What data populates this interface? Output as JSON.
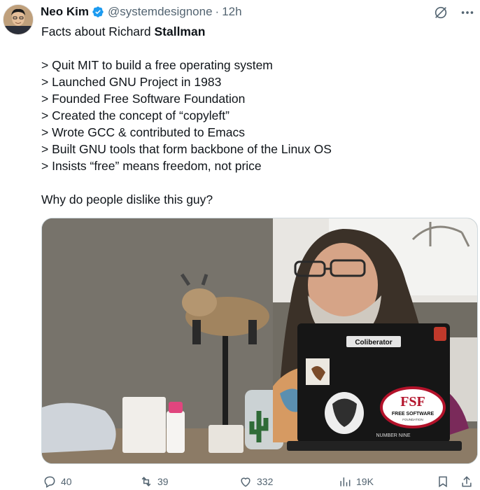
{
  "author": {
    "name": "Neo Kim",
    "handle": "@systemdesignone",
    "separator": "·",
    "time": "12h"
  },
  "tweet": {
    "title_prefix": "Facts about Richard ",
    "title_bold": "Stallman",
    "facts": [
      "> Quit MIT to build a free operating system",
      "> Launched GNU Project in 1983",
      "> Founded Free Software Foundation",
      "> Created the concept of “copyleft”",
      "> Wrote GCC & contributed to Emacs",
      "> Built GNU tools that form backbone of the Linux OS",
      "> Insists “free” means freedom, not price"
    ],
    "question": "Why do people dislike this guy?"
  },
  "media": {
    "laptop_sticker_brand": "Coliberator",
    "laptop_sticker_fsf": "FREE SOFTWARE",
    "laptop_sticker_fsf_sub": "FOUNDATION",
    "laptop_label": "NUMBER NINE"
  },
  "actions": {
    "replies": "40",
    "reposts": "39",
    "likes": "332",
    "views": "19K"
  },
  "colors": {
    "verified": "#1d9bf0",
    "muted": "#536471",
    "text": "#0f1419"
  },
  "icons": [
    "verified-badge-icon",
    "grok-icon",
    "more-icon",
    "reply-icon",
    "repost-icon",
    "like-icon",
    "views-icon",
    "bookmark-icon",
    "share-icon"
  ]
}
